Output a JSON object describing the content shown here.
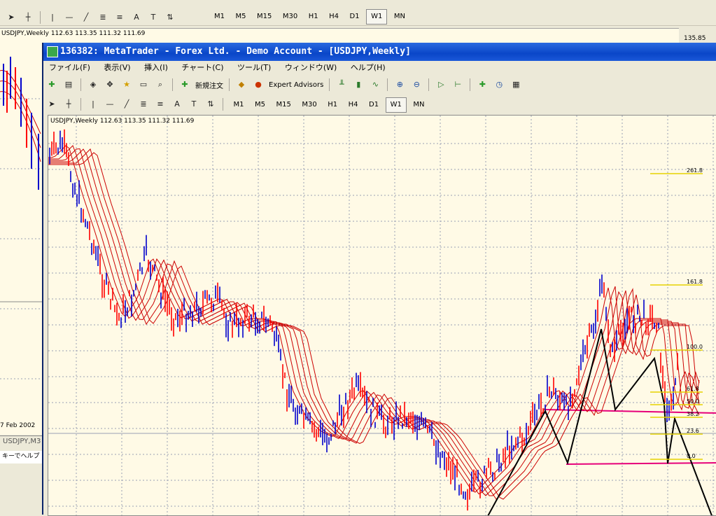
{
  "background_window": {
    "chart_title": "USDJPY,Weekly  112.63 113.35 111.32 111.69",
    "price_label": "135.85",
    "date_label": "7 Feb 2002",
    "tab_label": "USDJPY,M3",
    "status_text": "キーでヘルプ",
    "timeframes": [
      "M1",
      "M5",
      "M15",
      "M30",
      "H1",
      "H4",
      "D1",
      "W1",
      "MN"
    ],
    "active_timeframe": "W1"
  },
  "window": {
    "title": "136382: MetaTrader - Forex Ltd. - Demo Account - [USDJPY,Weekly]"
  },
  "menu": {
    "items": [
      "ファイル(F)",
      "表示(V)",
      "挿入(I)",
      "チャート(C)",
      "ツール(T)",
      "ウィンドウ(W)",
      "ヘルプ(H)"
    ]
  },
  "toolbar": {
    "new_order_label": "新規注文",
    "expert_advisors_label": "Expert Advisors"
  },
  "timeframes": {
    "items": [
      "M1",
      "M5",
      "M15",
      "M30",
      "H1",
      "H4",
      "D1",
      "W1",
      "MN"
    ],
    "active": "W1"
  },
  "chart": {
    "title": "USDJPY,Weekly  112.63 113.35 111.32 111.69",
    "fib_levels": [
      "261.8",
      "161.8",
      "100.0",
      "61.8",
      "50.0",
      "38.2",
      "23.6",
      "0.0"
    ],
    "colors": {
      "background": "#fffae6",
      "bull_candle": "#ff0000",
      "bear_candle": "#0000cc",
      "moving_averages": "#cc0000",
      "fib_lines": "#e6d200",
      "support_lines": "#e6007a",
      "zigzag": "#000000"
    }
  }
}
